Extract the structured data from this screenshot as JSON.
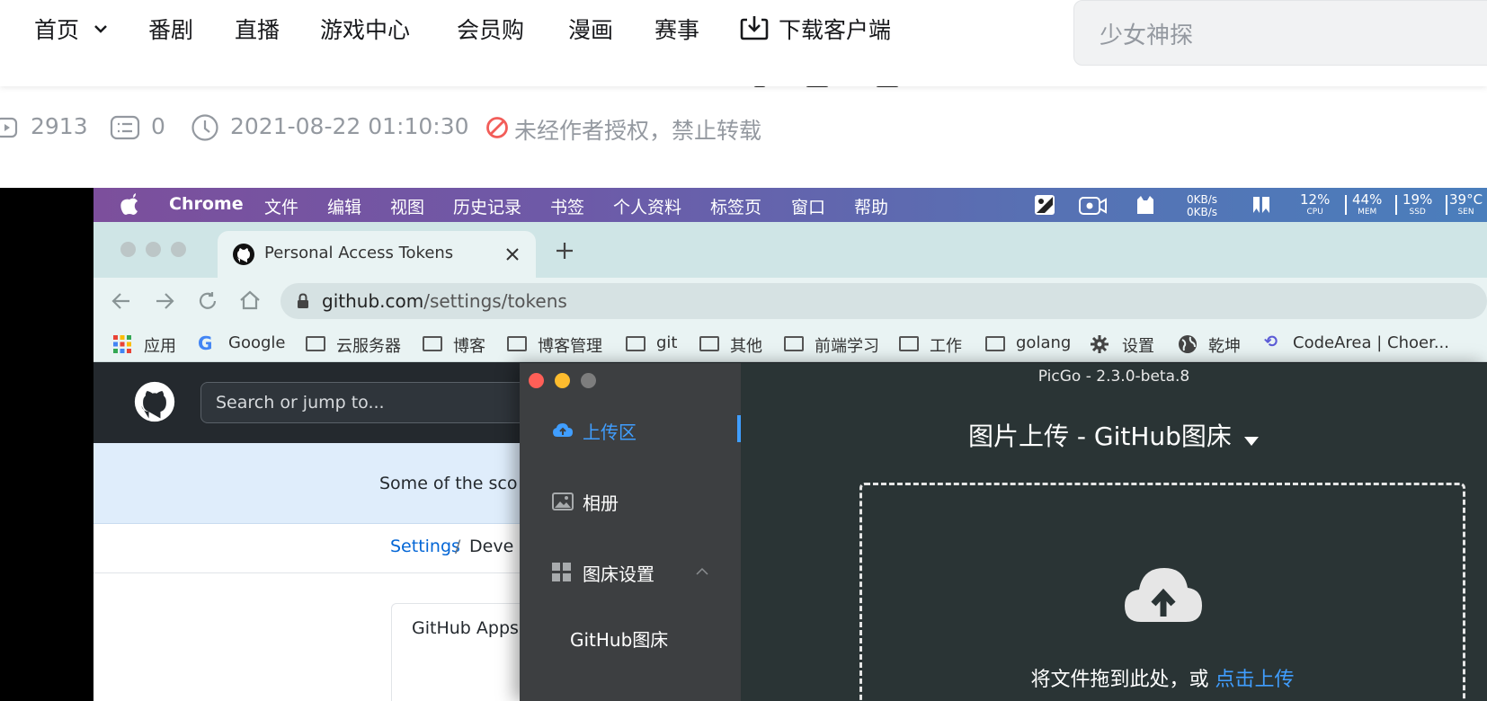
{
  "topnav": {
    "items": [
      "首页",
      "番剧",
      "直播",
      "游戏中心",
      "会员购",
      "漫画",
      "赛事",
      "下载客户端"
    ],
    "search_placeholder": "少女神探"
  },
  "meta": {
    "views": "2913",
    "comments": "0",
    "datetime": "2021-08-22 01:10:30",
    "copyright": "未经作者授权，禁止转载"
  },
  "menubar": {
    "app": "Chrome",
    "items": [
      "文件",
      "编辑",
      "视图",
      "历史记录",
      "书签",
      "个人资料",
      "标签页",
      "窗口",
      "帮助"
    ],
    "net_up": "0KB/s",
    "net_down": "0KB/s",
    "stats": [
      {
        "value": "12%",
        "label": "CPU"
      },
      {
        "value": "44%",
        "label": "MEM"
      },
      {
        "value": "19%",
        "label": "SSD"
      },
      {
        "value": "39°C",
        "label": "SEN"
      }
    ]
  },
  "browser": {
    "tab_title": "Personal Access Tokens",
    "url_host": "github.com",
    "url_path": "/settings/tokens",
    "bookmarks": [
      "应用",
      "Google",
      "云服务器",
      "博客",
      "博客管理",
      "git",
      "其他",
      "前端学习",
      "工作",
      "golang",
      "设置",
      "乾坤",
      "CodeArea | Choer..."
    ]
  },
  "github": {
    "search_placeholder": "Search or jump to...",
    "banner_text": "Some of the sco",
    "breadcrumb_settings": "Settings",
    "breadcrumb_sep": "/",
    "breadcrumb_next": "Deve",
    "sidebar_item": "GitHub Apps"
  },
  "picgo": {
    "window_title": "PicGo - 2.3.0-beta.8",
    "menu": [
      "上传区",
      "相册",
      "图床设置",
      "GitHub图床"
    ],
    "upload_title": "图片上传 - GitHub图床",
    "drop_text": "将文件拖到此处，或",
    "drop_link": "点击上传",
    "colors": {
      "accent": "#409eff",
      "sidebar": "#3d3f41",
      "main": "#2a3435"
    }
  }
}
